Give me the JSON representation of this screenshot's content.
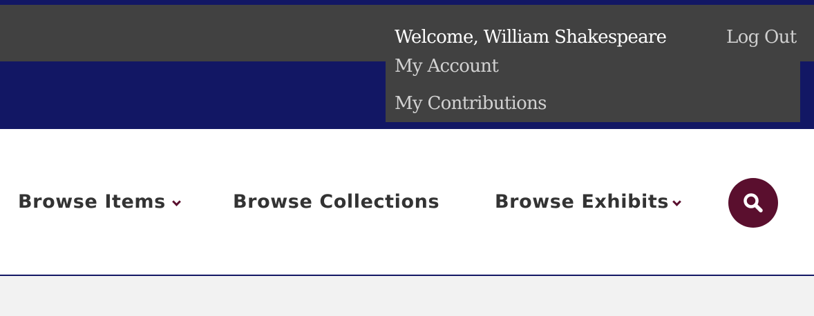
{
  "user_bar": {
    "welcome_text": "Welcome, William Shakespeare",
    "logout_label": "Log Out"
  },
  "user_menu": {
    "items": [
      {
        "label": "My Account"
      },
      {
        "label": "My Contributions"
      }
    ]
  },
  "nav": {
    "items": [
      {
        "label": "Browse Items",
        "has_dropdown": true
      },
      {
        "label": "Browse Collections",
        "has_dropdown": false
      },
      {
        "label": "Browse Exhibits",
        "has_dropdown": true
      }
    ],
    "search_icon": "search-icon"
  },
  "colors": {
    "header_blue": "#121764",
    "user_bar_gray": "#414141",
    "accent_maroon": "#5a0f2e",
    "nav_text": "#333333"
  }
}
